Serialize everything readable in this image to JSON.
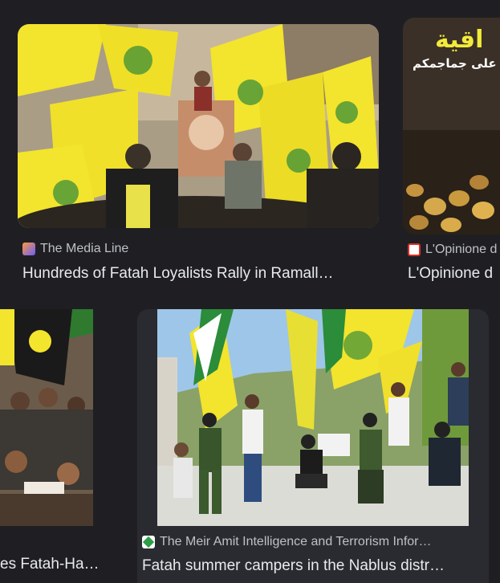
{
  "results": [
    {
      "source": "The Media Line",
      "title": "Hundreds of Fatah Loyalists Rally in Ramall…",
      "favicon_color": "#6a5cff"
    },
    {
      "source": "L'Opinione d",
      "title": "L'Opinione d",
      "image_text_line1": "اقية",
      "image_text_line2": "على جماجمكم",
      "favicon_color": "#d93025"
    },
    {
      "source": "",
      "title": "es Fatah-Ha…",
      "favicon_color": ""
    },
    {
      "source": "The Meir Amit Intelligence and Terrorism Infor…",
      "title": "Fatah summer campers in the Nablus distr…",
      "favicon_color": "#2e9d47"
    }
  ],
  "colors": {
    "background": "#1f1f23",
    "card": "#2a2b30",
    "flag_yellow": "#f3e42d",
    "flag_green": "#3b8f3a",
    "flag_red": "#d32a2a"
  }
}
